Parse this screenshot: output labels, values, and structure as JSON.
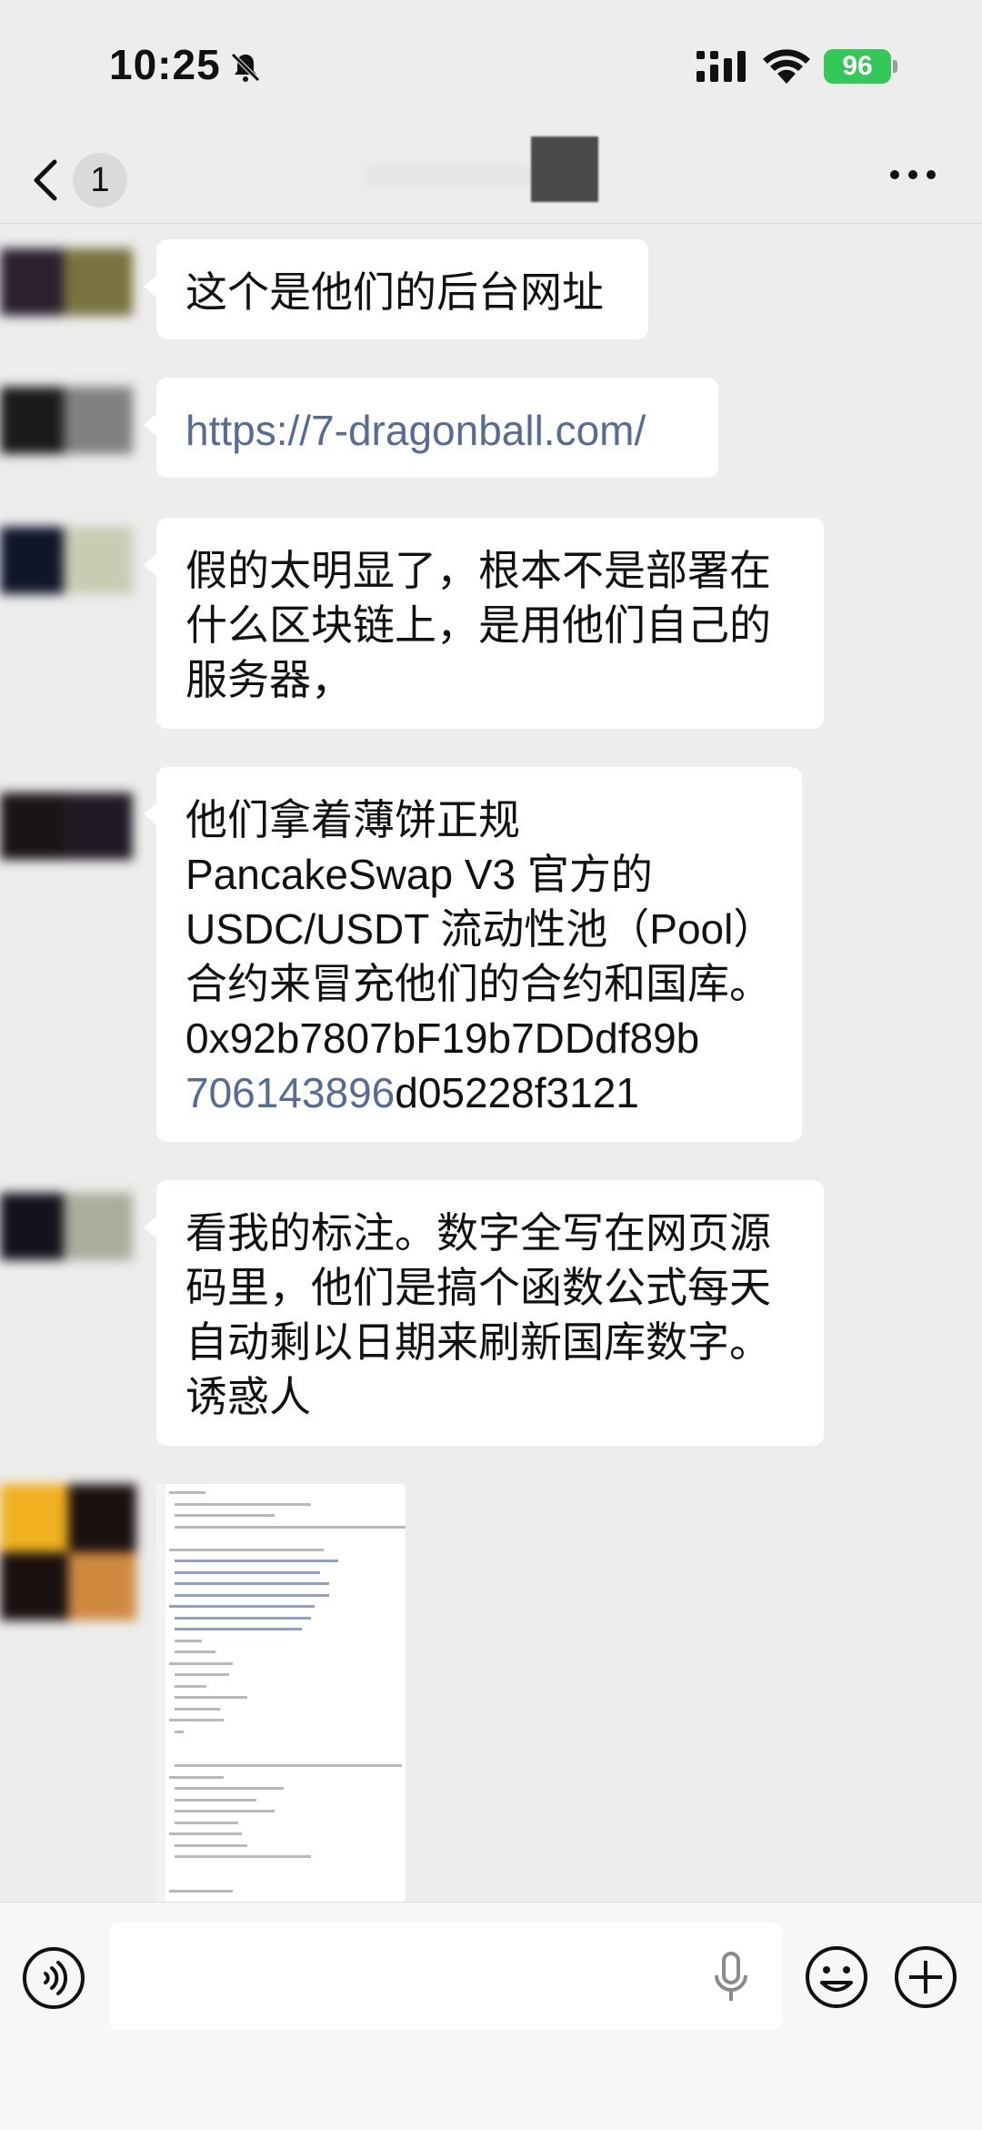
{
  "status_bar": {
    "time": "10:25",
    "battery": "96"
  },
  "nav": {
    "unread_count": "1"
  },
  "messages": [
    {
      "type": "text",
      "text": "这个是他们的后台网址"
    },
    {
      "type": "link",
      "text": "https://7-dragonball.com/"
    },
    {
      "type": "text",
      "lines": [
        "假的太明显了，根本不是部署在",
        "什么区块链上，是用他们自己的",
        "服务器，"
      ]
    },
    {
      "type": "text",
      "lines": [
        "他们拿着薄饼正规",
        "PancakeSwap V3 官方的",
        "USDC/USDT 流动性池（Pool）",
        "合约来冒充他们的合约和国库。",
        "0x92b7807bF19b7DDdf89b"
      ],
      "last_line_link": "706143896",
      "last_line_rest": "d05228f3121"
    },
    {
      "type": "text",
      "lines": [
        "看我的标注。数字全写在网页源",
        "码里，他们是搞个函数公式每天",
        "自动剩以日期来刷新国库数字。",
        "诱惑人"
      ]
    },
    {
      "type": "image",
      "description_icon": "code-screenshot"
    }
  ],
  "colors": {
    "background": "#ededed",
    "bubble": "#ffffff",
    "link": "#576b95",
    "battery": "#34c759"
  }
}
